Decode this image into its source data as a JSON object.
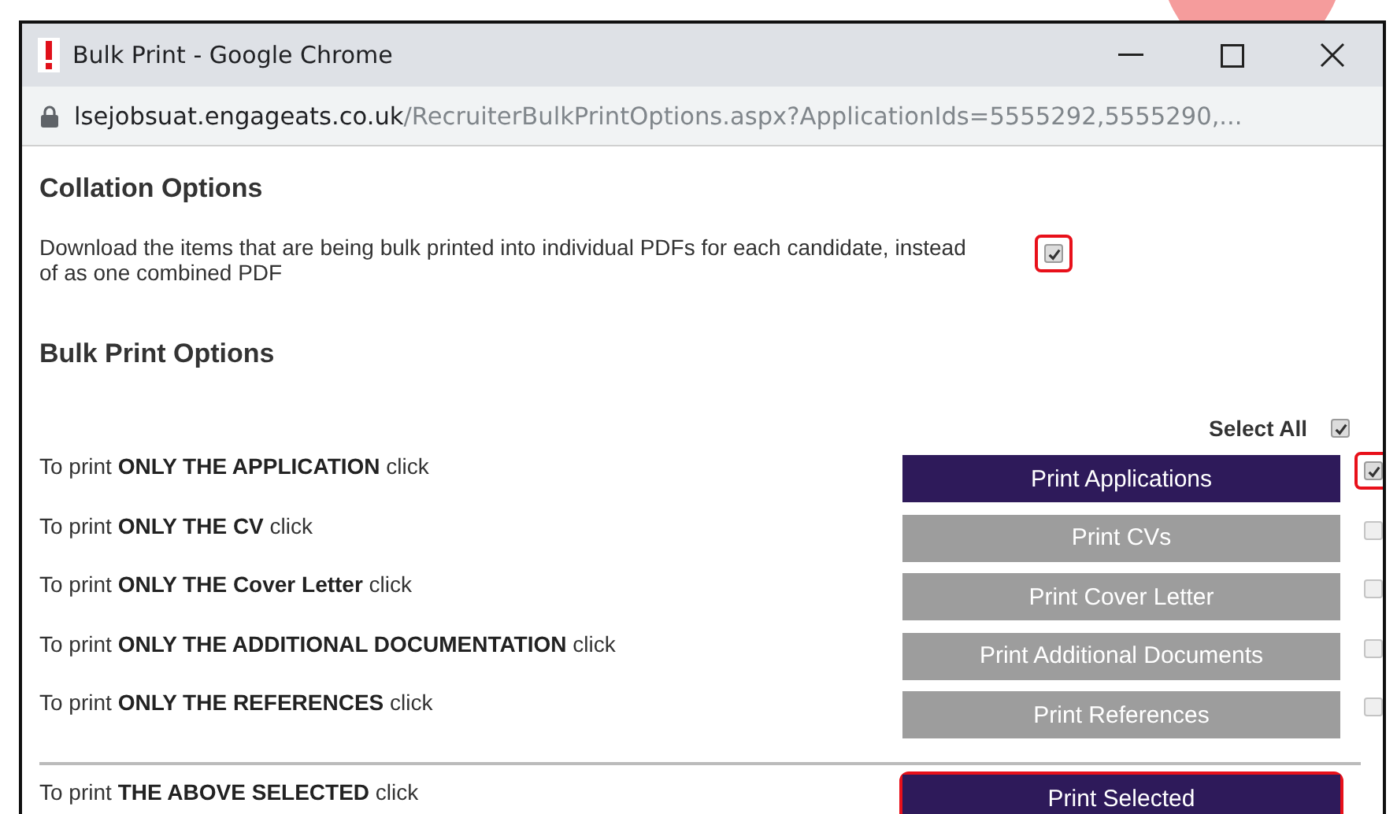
{
  "window": {
    "title": "Bulk Print - Google Chrome"
  },
  "address_bar": {
    "host": "lsejobsuat.engageats.co.uk",
    "path": "/RecruiterBulkPrintOptions.aspx?ApplicationIds=5555292,5555290,..."
  },
  "collation": {
    "heading": "Collation Options",
    "description": "Download the items that are being bulk printed into individual PDFs for each candidate, instead of as one combined PDF",
    "checked": true,
    "highlighted": true
  },
  "bulk_print": {
    "heading": "Bulk Print Options",
    "select_all": {
      "label": "Select All",
      "checked": true
    },
    "rows": [
      {
        "text": "To print **ONLY THE APPLICATION** click",
        "button": "Print Applications",
        "enabled": true,
        "checked": true,
        "highlighted": true
      },
      {
        "text": "To print **ONLY THE CV** click",
        "button": "Print CVs",
        "enabled": false,
        "checked": false,
        "highlighted": false
      },
      {
        "text": "To print **ONLY THE Cover Letter** click",
        "button": "Print Cover Letter",
        "enabled": false,
        "checked": false,
        "highlighted": false
      },
      {
        "text": "To print **ONLY THE ADDITIONAL DOCUMENTATION** click",
        "button": "Print Additional Documents",
        "enabled": false,
        "checked": false,
        "highlighted": false
      },
      {
        "text": "To print **ONLY THE REFERENCES** click",
        "button": "Print References",
        "enabled": false,
        "checked": false,
        "highlighted": false
      }
    ],
    "selected_row": {
      "text": "To print **THE ABOVE SELECTED** click",
      "button": "Print Selected",
      "enabled": true,
      "highlighted": true
    }
  }
}
